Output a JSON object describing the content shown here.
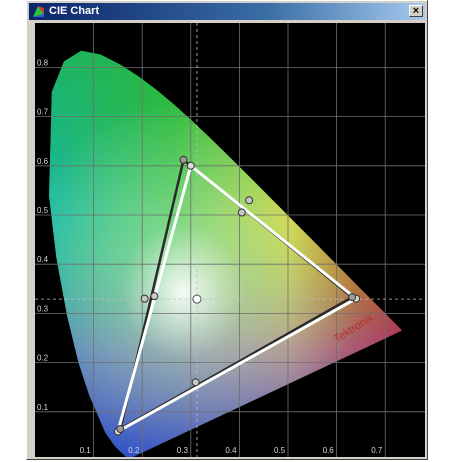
{
  "window": {
    "title": "CIE Chart",
    "close_glyph": "×"
  },
  "icons": {
    "app": "cie-chart-app-icon",
    "close": "close-icon"
  },
  "colors": {
    "background": "#000000",
    "grid": "#6f6f6f",
    "tick_label": "#d8d8d8",
    "reference_gamut": "#ffffff",
    "measured_gamut": "#2a2a2a",
    "crosshair": "#bfbfbf"
  },
  "chart_data": {
    "type": "scatter",
    "title": "",
    "xlabel": "",
    "ylabel": "",
    "xlim": [
      0.0,
      0.8
    ],
    "ylim": [
      0.0,
      0.9
    ],
    "grid": true,
    "x_ticks": [
      0.1,
      0.2,
      0.3,
      0.4,
      0.5,
      0.6,
      0.7
    ],
    "y_ticks": [
      0.1,
      0.2,
      0.3,
      0.4,
      0.5,
      0.6,
      0.7,
      0.8
    ],
    "watermark": "Tektronix",
    "series": [
      {
        "name": "",
        "role": "reference gamut",
        "points": [
          [
            0.64,
            0.33
          ],
          [
            0.3,
            0.6
          ],
          [
            0.15,
            0.06
          ]
        ]
      },
      {
        "name": "",
        "role": "measured gamut",
        "points": [
          [
            0.632,
            0.333
          ],
          [
            0.285,
            0.612
          ],
          [
            0.155,
            0.065
          ]
        ]
      },
      {
        "name": "",
        "role": "secondary markers",
        "points": [
          [
            0.42,
            0.53
          ],
          [
            0.405,
            0.505
          ],
          [
            0.205,
            0.33
          ],
          [
            0.225,
            0.335
          ],
          [
            0.31,
            0.16
          ]
        ]
      },
      {
        "name": "",
        "role": "white point",
        "points": [
          [
            0.3127,
            0.329
          ]
        ]
      }
    ]
  }
}
